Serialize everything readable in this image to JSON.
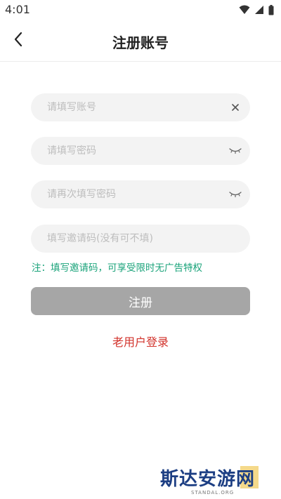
{
  "status_bar": {
    "time": "4:01",
    "icons": [
      "wifi-icon",
      "signal-icon",
      "battery-icon"
    ]
  },
  "header": {
    "title": "注册账号",
    "back_icon": "chevron-left-icon"
  },
  "form": {
    "account": {
      "placeholder": "请填写账号",
      "value": "",
      "icon": "clear-icon"
    },
    "password": {
      "placeholder": "请填写密码",
      "value": "",
      "icon": "eye-closed-icon"
    },
    "confirm_password": {
      "placeholder": "请再次填写密码",
      "value": "",
      "icon": "eye-closed-icon"
    },
    "invite_code": {
      "placeholder": "填写邀请码(没有可不填)",
      "value": ""
    },
    "note": "注：填写邀请码，可享受限时无广告特权",
    "register_label": "注册",
    "old_user_login": "老用户登录"
  },
  "watermark": {
    "text": "斯达安游网",
    "subtext": "STANDAL.ORG"
  },
  "colors": {
    "note_green": "#1aa37a",
    "login_red": "#d2322b",
    "button_gray": "#a6a6a6",
    "field_bg": "#f3f3f3"
  }
}
